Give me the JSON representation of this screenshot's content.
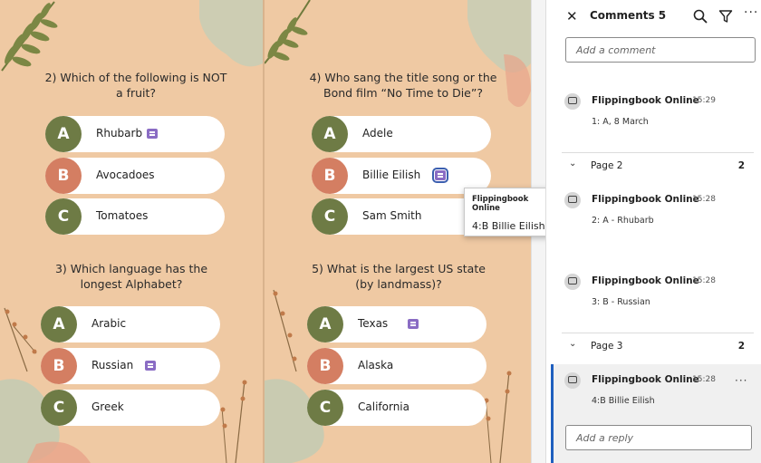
{
  "book": {
    "page_left": {
      "q2": {
        "question": "2) Which of the following is NOT a fruit?",
        "answers": [
          {
            "letter": "A",
            "text": "Rhubarb"
          },
          {
            "letter": "B",
            "text": "Avocadoes"
          },
          {
            "letter": "C",
            "text": "Tomatoes"
          }
        ]
      },
      "q3": {
        "question": "3) Which language has the longest Alphabet?",
        "answers": [
          {
            "letter": "A",
            "text": "Arabic"
          },
          {
            "letter": "B",
            "text": "Russian"
          },
          {
            "letter": "C",
            "text": "Greek"
          }
        ]
      }
    },
    "page_right": {
      "q4": {
        "question": "4) Who sang the title song or the Bond film “No Time to Die”?",
        "answers": [
          {
            "letter": "A",
            "text": "Adele"
          },
          {
            "letter": "B",
            "text": "Billie Eilish"
          },
          {
            "letter": "C",
            "text": "Sam Smith"
          }
        ]
      },
      "q5": {
        "question": "5) What is the largest US state (by landmass)?",
        "answers": [
          {
            "letter": "A",
            "text": "Texas"
          },
          {
            "letter": "B",
            "text": "Alaska"
          },
          {
            "letter": "C",
            "text": "California"
          }
        ]
      }
    },
    "tooltip": {
      "author": "Flippingbook Online",
      "body": "4:B Billie Eilish"
    }
  },
  "panel": {
    "title": "Comments 5",
    "add_comment_placeholder": "Add a comment",
    "comments": [
      {
        "author": "Flippingbook Online",
        "time": "15:29",
        "body": "1: A, 8 March"
      },
      {
        "author": "Flippingbook Online",
        "time": "15:28",
        "body": "2: A - Rhubarb"
      },
      {
        "author": "Flippingbook Online",
        "time": "15:28",
        "body": "3: B - Russian"
      },
      {
        "author": "Flippingbook Online",
        "time": "15:28",
        "body": "4:B Billie Eilish"
      }
    ],
    "groups": [
      {
        "label": "Page 2",
        "count": "2"
      },
      {
        "label": "Page 3",
        "count": "2"
      }
    ],
    "reply_placeholder": "Add a reply"
  },
  "colors": {
    "page_bg": "#efc9a3",
    "circle_green": "#6e7b45",
    "circle_orange": "#d47e62",
    "marker_purple": "#8a6cc4",
    "active_bar": "#1f5fbf"
  },
  "icons": [
    "close-icon",
    "search-icon",
    "filter-icon",
    "more-icon",
    "comment-icon",
    "chevron-down-icon"
  ]
}
